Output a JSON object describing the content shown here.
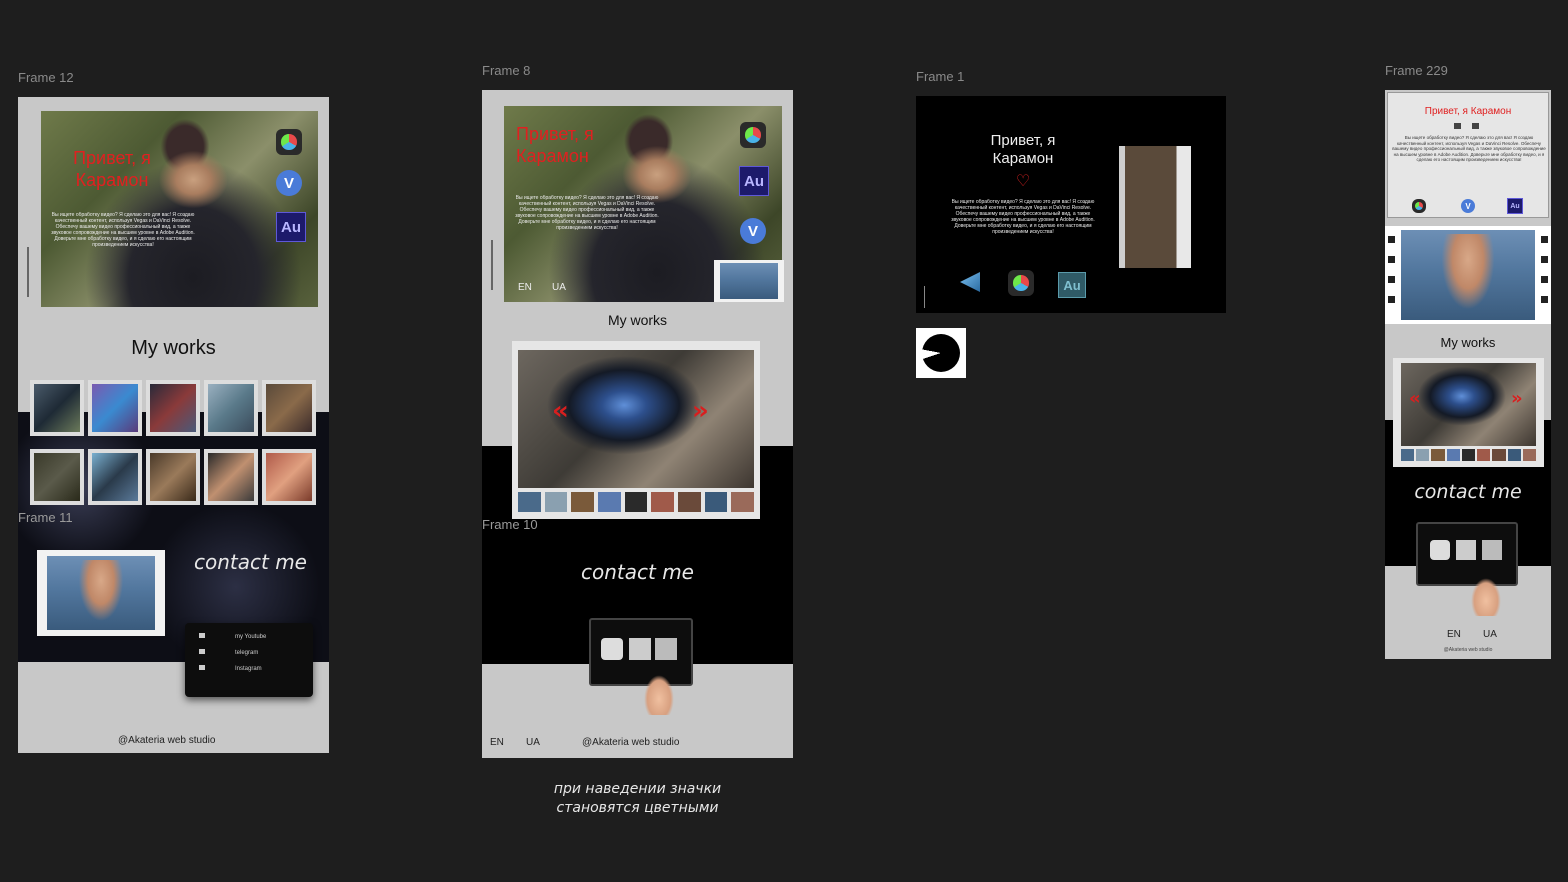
{
  "frames": {
    "f12": {
      "label": "Frame 12"
    },
    "f8": {
      "label": "Frame 8"
    },
    "f1": {
      "label": "Frame 1"
    },
    "f229": {
      "label": "Frame 229"
    },
    "f11": {
      "label": "Frame 11"
    },
    "f10": {
      "label": "Frame 10"
    }
  },
  "hero": {
    "greeting_two_lines_a": "Привет, я",
    "greeting_two_lines_b": "Карамон",
    "greeting_one_line": "Привет, я Карамон",
    "bio": "Вы ищете обработку видео? Я сделаю это для вас! Я создаю качественный контент, используя Vegas и DaVinci Resolve. Обеспечу вашему видео профессиональный вид, а также звуковое сопровождение на высшем уровне в Adobe Audition. Доверьте мне обработку видео, и я сделаю его настоящим произведением искусства!",
    "badge_au": "Au",
    "badge_v": "V"
  },
  "works_title": "My works",
  "contact_title": "contact me",
  "footer": "@Akateria web studio",
  "lang": {
    "en": "EN",
    "ua": "UA"
  },
  "contact_menu": [
    {
      "icon": "youtube-icon",
      "label": "my Youtube"
    },
    {
      "icon": "telegram-icon",
      "label": "telegram"
    },
    {
      "icon": "instagram-icon",
      "label": "Instagram"
    }
  ],
  "note": {
    "line1": "при наведении значки",
    "line2": "становятся цветными"
  },
  "nav": {
    "prev": "«",
    "next": "»"
  },
  "colors": {
    "canvas": "#1e1e1e",
    "accent_red": "#e02020",
    "page_gray": "#c8c8c8"
  }
}
